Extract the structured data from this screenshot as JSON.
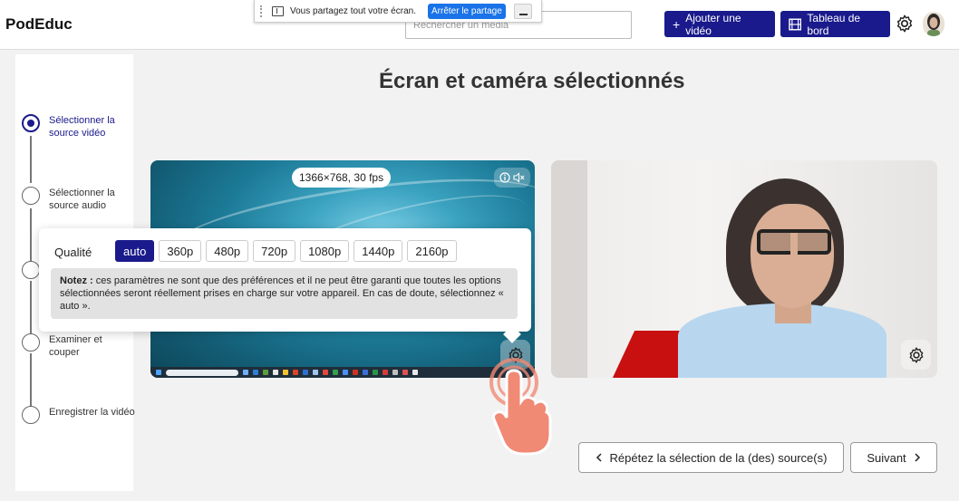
{
  "header": {
    "brand": "PodEduc",
    "search_placeholder": "Rechercher un média",
    "add_video_label": "Ajouter une vidéo",
    "dashboard_label": "Tableau de bord"
  },
  "share_bar": {
    "message": "Vous partagez tout votre écran.",
    "stop_label": "Arrêter le partage"
  },
  "sidebar": {
    "steps": [
      {
        "label": "Sélectionner la source vidéo",
        "active": true
      },
      {
        "label": "Sélectionner la source audio",
        "active": false
      },
      {
        "label": "",
        "active": false
      },
      {
        "label": "Examiner et couper",
        "active": false
      },
      {
        "label": "Enregistrer la vidéo",
        "active": false
      }
    ]
  },
  "main": {
    "title": "Écran et caméra sélectionnés",
    "screen_preview": {
      "resolution": "1366×768, 30 fps"
    }
  },
  "quality_popup": {
    "label": "Qualité",
    "options": [
      "auto",
      "360p",
      "480p",
      "720p",
      "1080p",
      "1440p",
      "2160p"
    ],
    "selected": "auto",
    "note_bold": "Notez :",
    "note_text": " ces paramètres ne sont que des préférences et il ne peut être garanti que toutes les options sélectionnées seront réellement prises en charge sur votre appareil. En cas de doute, sélectionnez « auto »."
  },
  "footer": {
    "back_label": "Répétez la sélection de la (des) source(s)",
    "next_label": "Suivant"
  },
  "colors": {
    "primary": "#1a1a8c",
    "share_button": "#1a73e8",
    "cursor": "#f08a75"
  }
}
